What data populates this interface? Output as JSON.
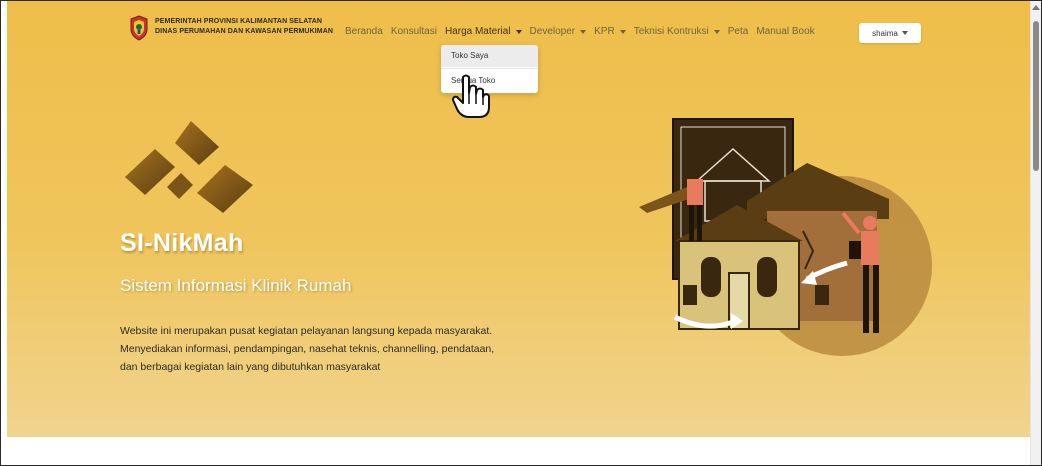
{
  "brand": {
    "line1": "PEMERINTAH PROVINSI KALIMANTAN SELATAN",
    "line2": "DINAS PERUMAHAN DAN KAWASAN PERMUKIMAN"
  },
  "nav": {
    "items": [
      {
        "label": "Beranda",
        "has_caret": false
      },
      {
        "label": "Konsultasi",
        "has_caret": false
      },
      {
        "label": "Harga Material",
        "has_caret": true
      },
      {
        "label": "Developer",
        "has_caret": true
      },
      {
        "label": "KPR",
        "has_caret": true
      },
      {
        "label": "Teknisi Kontruksi",
        "has_caret": true
      },
      {
        "label": "Peta",
        "has_caret": false
      },
      {
        "label": "Manual Book",
        "has_caret": false
      }
    ],
    "user": "shaima"
  },
  "dropdown": {
    "items": [
      "Toko Saya",
      "Semua Toko"
    ]
  },
  "hero": {
    "title": "SI-NikMah",
    "subtitle": "Sistem Informasi Klinik Rumah",
    "description": [
      "Website ini merupakan pusat kegiatan pelayanan langsung kepada masyarakat.",
      "Menyediakan informasi, pendampingan, nasehat teknis, channelling, pendataan,",
      "dan berbagai kegiatan lain yang dibutuhkan masyarakat"
    ]
  },
  "colors": {
    "hero_top": "#efbe4a",
    "hero_bottom": "#f1d48e",
    "accent_dark": "#5a3d12"
  },
  "icons": {
    "logo": "provincial-emblem-icon",
    "cursor": "hand-pointer-icon",
    "scroll_up": "chevron-up-icon"
  }
}
